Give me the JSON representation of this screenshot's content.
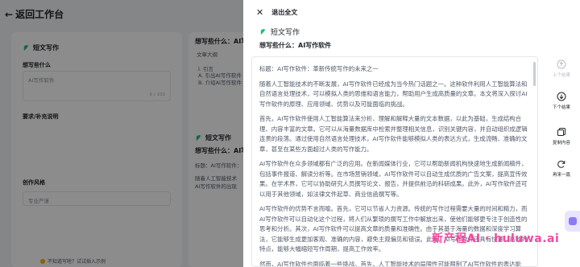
{
  "background": {
    "back_label": "返回工作台",
    "left_card": {
      "product_name": "短文写作",
      "topic_label": "想写些什么",
      "topic_value": "AI写作软件",
      "topic_count": "6 / 100",
      "requirements_label": "要求/补充说明",
      "genre_label": "创作风格",
      "genre_value": "专业严谨",
      "hint_text": "不知道写啥？试试插入示例"
    },
    "mid_card": {
      "outline_title": "想写些什么：AI写作",
      "outline_label": "文章大纲",
      "outline_items": [
        "I. 引言",
        "A. 引出AI写作软件",
        "B. 介绍AI写作软件"
      ],
      "product_name": "短文写作",
      "topic_title": "想写些什么：AI写",
      "body_snippet": [
        "标题：AI写作软件：",
        "随着人工智能技术",
        "AI写作软件的出现"
      ]
    }
  },
  "drawer": {
    "close_icon": "close-icon",
    "title": "退出全文",
    "product_name": "短文写作",
    "topic": "想写些什么：AI写作软件",
    "paragraphs": [
      "标题：AI写作软件：革新传统写作的未来之一",
      "随着人工智能技术的不断发展，AI写作软件已经成为当今热门话题之一。这种软件利用人工智能算法和自然语言处理技术，可以模拟人类的思维和语言能力，帮助用户生成高质量的文章。本文将深入探讨AI写作软件的原理、应用领域、优势以及可能面临的挑战。",
      "首先，AI写作软件使用人工智能算法来分析、理解和解释大量的文本数据，以此为基础，生成结构合理、内容丰富的文章。它可以从海量数据库中检索并整理相关信息，识别关键内容，并自动组织成逻辑连贯的段落。通过使用自然语言处理技术，AI写作软件能够模拟人类的表达方式，生成流畅、准确的文章，甚至在某些方面超过人类的写作能力。",
      "AI写作软件在众多领域都有广泛的应用。在新闻媒体行业，它可以帮助新闻机构快速地生成新闻稿件，包括事件报道、解读分析等。在市场营销领域，AI写作软件可以自动生成优质的广告文案，提高宣传效果。在学术界，它可以协助研究人员撰写论文、报告，并提供前沿的科研成果。此外，AI写作软件还可以用于其他领域，如法律文件起草、商业信函撰写等。",
      "AI写作软件的优势不言而喻。首先，它可以节省人力资源。传统的写作过程需要大量的时间和精力，而AI写作软件可以自动化这个过程，将人们从繁琐的撰写工作中解放出来，使他们能够更专注于创造性的思考和分析。其次，AI写作软件可以提高文章的质量和准确性。由于其基于海量的数据和深度学习算法，它能够生成更加客观、准确的内容，避免主观偏见和错误。此外，AI写作软件还具有快速、高效的特点，能够大幅缩短写作周期，提高工作效率。",
      "然而，AI写作软件也面临着一些挑战。首先，人工智能技术的局限性可能限制了AI写作软件的表达能力。"
    ],
    "tools": [
      {
        "icon": "arrow-up-icon",
        "label": "上个结果"
      },
      {
        "icon": "arrow-down-icon",
        "label": "下个结果"
      },
      {
        "icon": "copy-icon",
        "label": "复制内容"
      },
      {
        "icon": "redo-icon",
        "label": "再来一篇"
      }
    ]
  },
  "watermark": "新产程AI · huluwa.ai"
}
